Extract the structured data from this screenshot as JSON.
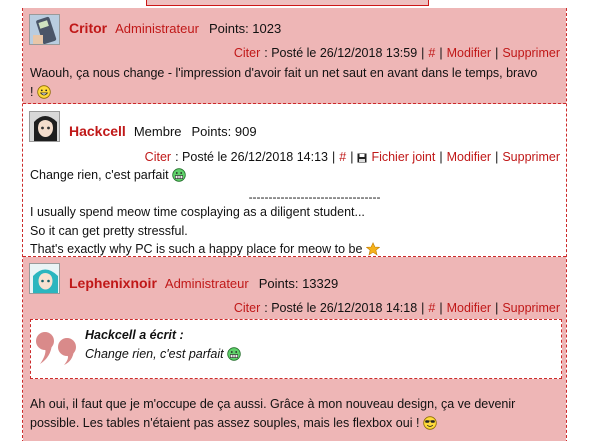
{
  "colors": {
    "accent": "#c01818",
    "post_bg": "#eeb6b6",
    "border": "#cc2a2a"
  },
  "posts": [
    {
      "author": "Critor",
      "role": "Administrateur",
      "points": "Points: 1023",
      "cite": "Citer",
      "posted": ": Posté le 26/12/2018 13:59",
      "hash": "#",
      "modify": "Modifier",
      "delete": "Supprimer",
      "avatar_icon": "calculator-avatar-icon",
      "lines": [
        "Waouh, ça nous change - l'impression d'avoir fait un net saut en avant dans le temps, bravo",
        "!"
      ],
      "emoji_icon": "grin-emoji-icon"
    },
    {
      "author": "Hackcell",
      "role": "Membre",
      "points": "Points: 909",
      "cite": "Citer",
      "posted": ": Posté le 26/12/2018 14:13",
      "hash": "#",
      "attachment": "Fichier joint",
      "modify": "Modifier",
      "delete": "Supprimer",
      "avatar_icon": "anime-girl-avatar-icon",
      "line1": "Change rien, c'est parfait",
      "separator": "---------------------------------",
      "line2": "I usually spend meow time cosplaying as a diligent student...",
      "line3": "So it can get pretty stressful.",
      "line4": "That's exactly why PC is such a happy place for meow to be",
      "emoji_icons": [
        "grimace-emoji-icon",
        "star-emoji-icon"
      ]
    },
    {
      "author": "Lephenixnoir",
      "role": "Administrateur",
      "points": "Points: 13329",
      "cite": "Citer",
      "posted": ": Posté le 26/12/2018 14:18",
      "hash": "#",
      "modify": "Modifier",
      "delete": "Supprimer",
      "avatar_icon": "teal-hair-avatar-icon",
      "quote_author": "Hackcell a écrit :",
      "quote_text": "Change rien, c'est parfait",
      "line1": "Ah oui, il faut que je m'occupe de ça aussi. Grâce à mon nouveau design, ça ve devenir",
      "line2": "possible. Les tables n'étaient pas assez souples, mais les flexbox oui !",
      "emoji_icons": [
        "grimace-emoji-icon",
        "sunglasses-emoji-icon"
      ]
    }
  ]
}
